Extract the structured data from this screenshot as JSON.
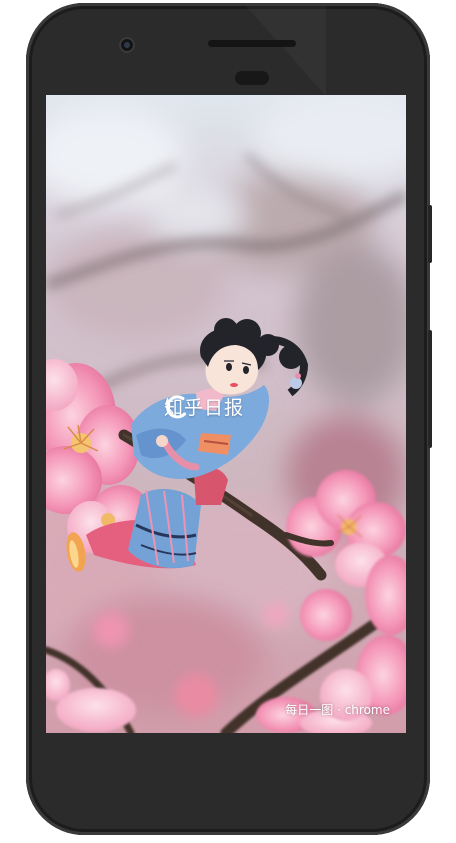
{
  "splash": {
    "app_name": "知乎日报",
    "image_caption": "每日一图 · chrome"
  },
  "colors": {
    "device_body": "#2b2b2b",
    "blossom_pink": "#f28fb3",
    "kimono_blue": "#6f9fd6",
    "text": "#ffffff"
  },
  "icons": {
    "logo": "zhihu-daily-logo-icon",
    "camera": "front-camera-icon",
    "speaker": "earpiece-speaker-icon"
  }
}
